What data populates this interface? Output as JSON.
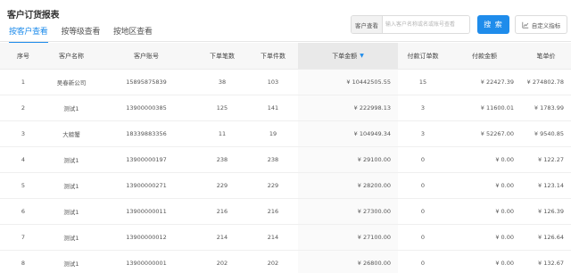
{
  "page": {
    "title": "客户订货报表"
  },
  "tabs": [
    {
      "label": "按客户查看",
      "active": true
    },
    {
      "label": "按等级查看",
      "active": false
    },
    {
      "label": "按地区查看",
      "active": false
    }
  ],
  "search": {
    "label": "客户查看",
    "placeholder": "输入客户名称或名或账号查看",
    "value": "",
    "button_label": "搜 索"
  },
  "custom_metrics": {
    "label": "自定义指标",
    "icon": "chart-icon"
  },
  "table": {
    "columns": [
      "序号",
      "客户名称",
      "客户账号",
      "下单笔数",
      "下单件数",
      "下单金额",
      "付款订单数",
      "付款金额",
      "笔单价"
    ],
    "sorted_column": "下单金额",
    "sort_direction": "desc",
    "rows": [
      [
        "1",
        "吴春新公司",
        "15895875839",
        "38",
        "103",
        "¥ 10442505.55",
        "15",
        "¥ 22427.39",
        "¥ 274802.78"
      ],
      [
        "2",
        "测试1",
        "13900000385",
        "125",
        "141",
        "¥ 222998.13",
        "3",
        "¥ 11600.01",
        "¥ 1783.99"
      ],
      [
        "3",
        "大螃蟹",
        "18339883356",
        "11",
        "19",
        "¥ 104949.34",
        "3",
        "¥ 52267.00",
        "¥ 9540.85"
      ],
      [
        "4",
        "测试1",
        "13900000197",
        "238",
        "238",
        "¥ 29100.00",
        "0",
        "¥ 0.00",
        "¥ 122.27"
      ],
      [
        "5",
        "测试1",
        "13900000271",
        "229",
        "229",
        "¥ 28200.00",
        "0",
        "¥ 0.00",
        "¥ 123.14"
      ],
      [
        "6",
        "测试1",
        "13900000011",
        "216",
        "216",
        "¥ 27300.00",
        "0",
        "¥ 0.00",
        "¥ 126.39"
      ],
      [
        "7",
        "测试1",
        "13900000012",
        "214",
        "214",
        "¥ 27100.00",
        "0",
        "¥ 0.00",
        "¥ 126.64"
      ],
      [
        "8",
        "测试1",
        "13900000001",
        "202",
        "202",
        "¥ 26800.00",
        "0",
        "¥ 0.00",
        "¥ 132.67"
      ]
    ]
  }
}
